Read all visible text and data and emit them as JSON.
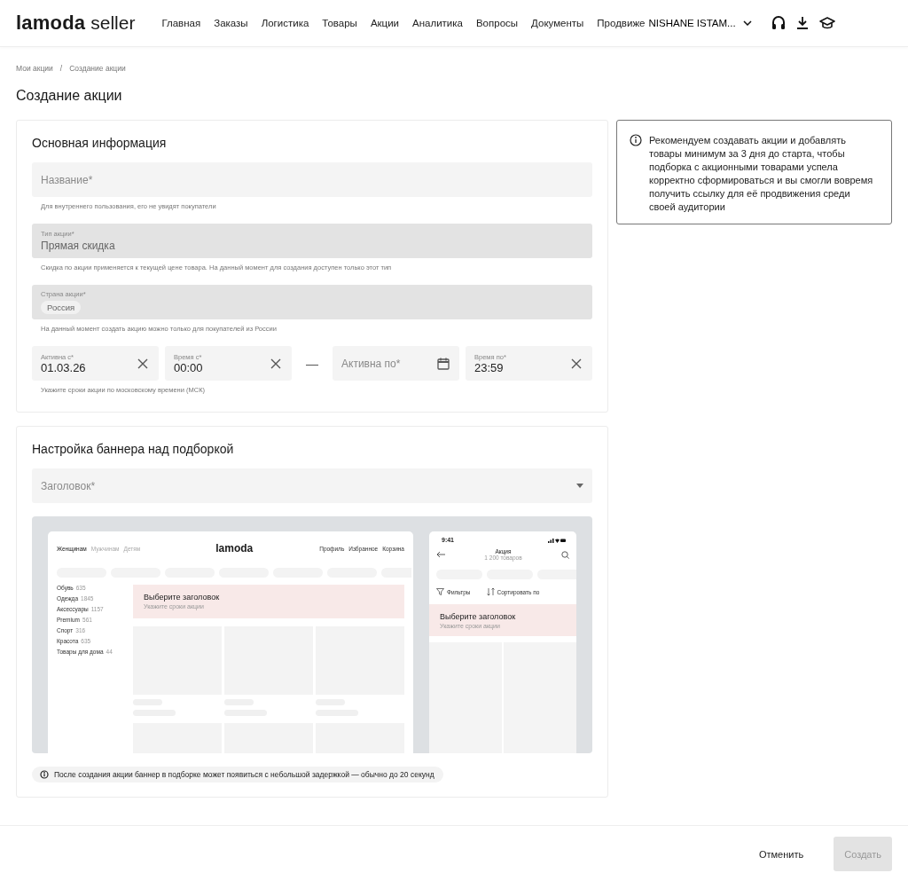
{
  "header": {
    "logo": "lamoda",
    "logo_suffix": "seller",
    "nav": [
      {
        "label": "Главная"
      },
      {
        "label": "Заказы"
      },
      {
        "label": "Логистика"
      },
      {
        "label": "Товары"
      },
      {
        "label": "Акции"
      },
      {
        "label": "Аналитика"
      },
      {
        "label": "Вопросы"
      },
      {
        "label": "Документы"
      },
      {
        "label": "Продвиже"
      }
    ],
    "account": "NISHANE ISTAM..."
  },
  "breadcrumbs": [
    "Мои акции",
    "Создание акции"
  ],
  "breadcrumb_separator": "/",
  "title": "Создание акции",
  "main_info": {
    "heading": "Основная информация",
    "fields": [
      {
        "kind": "input",
        "placeholder": "Название*",
        "disabled": false,
        "hint": "Для внутреннего пользования, его не увидят покупатели"
      },
      {
        "kind": "select",
        "label": "Тип акции*",
        "value": "Прямая скидка",
        "disabled": true,
        "hint": "Скидка по акции применяется к текущей цене товара. На данный момент для создания доступен только этот тип"
      },
      {
        "kind": "chips",
        "label": "Страна акции*",
        "chips": [
          "Россия"
        ],
        "disabled": true,
        "hint": "На данный момент создать акцию можно только для покупателей из России"
      }
    ],
    "dates": [
      {
        "kind": "clearable",
        "label": "Активна с*",
        "value": "01.03.26"
      },
      {
        "kind": "clearable",
        "label": "Время с*",
        "value": "00:00"
      },
      {
        "kind": "datepicker",
        "placeholder": "Активна по*"
      },
      {
        "kind": "clearable",
        "label": "Время по*",
        "value": "23:59"
      }
    ],
    "date_separator": "—",
    "dates_hint": "Укажите сроки акции по московскому времени (МСК)"
  },
  "notice": "Рекомендуем создавать акции и добавлять товары минимум за 3 дня до старта, чтобы подборка с акционными товарами успела корректно сформироваться и вы смогли вовремя получить ссылку для её продвижения среди своей аудитории",
  "banner": {
    "heading": "Настройка баннера над подборкой",
    "headline_placeholder": "Заголовок*",
    "desktop": {
      "tabs": [
        {
          "label": "Женщинам",
          "selected": true
        },
        {
          "label": "Мужчинам",
          "selected": false
        },
        {
          "label": "Детям",
          "selected": false
        }
      ],
      "logo": "lamoda",
      "links": [
        "Профиль",
        "Избранное",
        "Корзина"
      ],
      "categories": [
        {
          "name": "Обувь",
          "count": "635"
        },
        {
          "name": "Одежда",
          "count": "1845"
        },
        {
          "name": "Аксессуары",
          "count": "1157"
        },
        {
          "name": "Premium",
          "count": "561"
        },
        {
          "name": "Спорт",
          "count": "316"
        },
        {
          "name": "Красота",
          "count": "635"
        },
        {
          "name": "Товары для дома",
          "count": "44"
        }
      ],
      "banner_title": "Выберите заголовок",
      "banner_subtitle": "Укажите сроки акции"
    },
    "mobile": {
      "time": "9:41",
      "title": "Акция",
      "subtitle": "1 200 товаров",
      "filter": "Фильтры",
      "sort": "Сортировать по",
      "banner_title": "Выберите заголовок",
      "banner_subtitle": "Укажите сроки акции"
    },
    "note": "После создания акции баннер в подборке может появиться с небольшой задержкой — обычно до 20 секунд"
  },
  "footer": {
    "buttons": [
      {
        "label": "Отменить",
        "kind": "text",
        "disabled": false
      },
      {
        "label": "Создать",
        "kind": "primary",
        "disabled": true
      }
    ]
  }
}
